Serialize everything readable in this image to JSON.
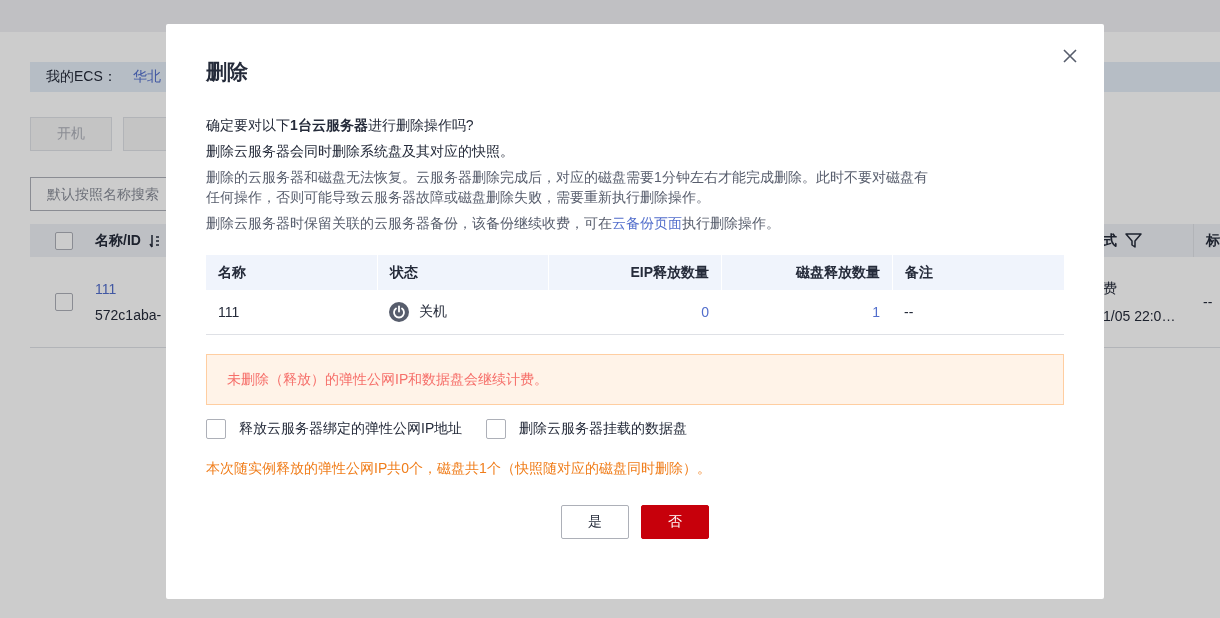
{
  "background": {
    "info_label": "我的ECS：",
    "info_link": "华北",
    "buttons": [
      "开机"
    ],
    "search": {
      "placeholder": "默认按照名称搜索"
    },
    "table": {
      "all_selected": false,
      "columns": [
        "名称/ID",
        "式",
        "标"
      ],
      "row": {
        "selected": false,
        "name": "111",
        "id": "572c1aba-",
        "column_2_line_1": "费",
        "column_2_line_2": "1/05 22:0…",
        "column_3": "--"
      }
    }
  },
  "dialog": {
    "title": "删除",
    "lines": [
      {
        "kind": "strong",
        "text": "确定要对以下**1台云服务器**进行删除操作吗?"
      },
      {
        "kind": "strong",
        "text": "删除云服务器会同时删除系统盘及其对应的快照。"
      },
      {
        "kind": "muted",
        "text": "删除的云服务器和磁盘无法恢复。云服务器删除完成后，对应的磁盘需要1分钟左右才能完成删除。此时不要对磁盘有任何操作，否则可能导致云服务器故障或磁盘删除失败，需要重新执行删除操作。"
      },
      {
        "kind": "link",
        "text": "删除云服务器时保留关联的云服务器备份，该备份继续收费，可在",
        "link": "云备份页面",
        "after": "执行删除操作。"
      }
    ],
    "table": {
      "columns": [
        "名称",
        "状态",
        "EIP释放数量",
        "磁盘释放数量",
        "备注"
      ],
      "rows": [
        {
          "name": "111",
          "status": "关机",
          "eip": "0",
          "disk": "1",
          "note": "--"
        }
      ]
    },
    "alert": "未删除（释放）的弹性公网IP和数据盘会继续计费。",
    "options": [
      {
        "label": "释放云服务器绑定的弹性公网IP地址",
        "checked": false
      },
      {
        "label": "删除云服务器挂载的数据盘",
        "checked": false
      }
    ],
    "summary": "本次随实例释放的弹性公网IP共0个，磁盘共1个（快照随对应的磁盘同时删除）。",
    "buttons": [
      {
        "label": "是",
        "kind": "secondary"
      },
      {
        "label": "否",
        "kind": "primary"
      }
    ]
  }
}
